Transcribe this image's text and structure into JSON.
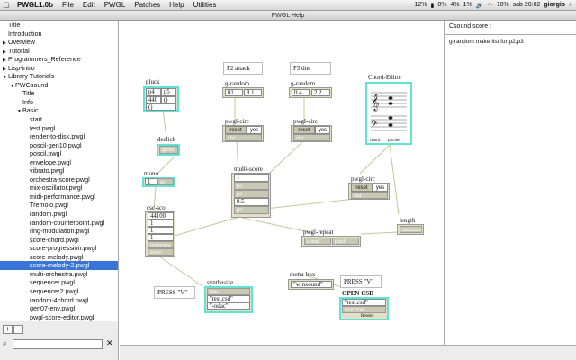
{
  "menubar": {
    "apple": "",
    "app": "PWGL1.0b",
    "items": [
      "File",
      "Edit",
      "PWGL",
      "Patches",
      "Help",
      "Utilities"
    ],
    "status": {
      "battery_pct": "12%",
      "cpu1": "0%",
      "cpu2": "4%",
      "mem": "1%",
      "wifi_pct": "70%",
      "clock": "sab 20:02",
      "user": "giorgio"
    }
  },
  "window": {
    "title": "PWGL Help"
  },
  "sidebar": {
    "items": [
      {
        "label": "Title",
        "indent": 0,
        "tri": ""
      },
      {
        "label": "Introduction",
        "indent": 0,
        "tri": ""
      },
      {
        "label": "Overview",
        "indent": 0,
        "tri": "▶"
      },
      {
        "label": "Tutorial",
        "indent": 0,
        "tri": "▶"
      },
      {
        "label": "Programmers_Reference",
        "indent": 0,
        "tri": "▶"
      },
      {
        "label": "Lisp-intro",
        "indent": 0,
        "tri": "▶"
      },
      {
        "label": "Library Tutorials",
        "indent": 0,
        "tri": "▼"
      },
      {
        "label": "PWCsound",
        "indent": 1,
        "tri": "▼"
      },
      {
        "label": "Title",
        "indent": 2,
        "tri": ""
      },
      {
        "label": "Info",
        "indent": 2,
        "tri": ""
      },
      {
        "label": "Basic",
        "indent": 2,
        "tri": "▼"
      },
      {
        "label": "start",
        "indent": 3,
        "tri": ""
      },
      {
        "label": "test.pwgl",
        "indent": 3,
        "tri": ""
      },
      {
        "label": "render-to-disk.pwgl",
        "indent": 3,
        "tri": ""
      },
      {
        "label": "poscil-gen10.pwgl",
        "indent": 3,
        "tri": ""
      },
      {
        "label": "poscil.pwgl",
        "indent": 3,
        "tri": ""
      },
      {
        "label": "envelope.pwgl",
        "indent": 3,
        "tri": ""
      },
      {
        "label": "vibrato.pwgl",
        "indent": 3,
        "tri": ""
      },
      {
        "label": "orchestra-score.pwgl",
        "indent": 3,
        "tri": ""
      },
      {
        "label": "mix-oscillator.pwgl",
        "indent": 3,
        "tri": ""
      },
      {
        "label": "midi-performance.pwgl",
        "indent": 3,
        "tri": ""
      },
      {
        "label": "Tremolo.pwgl",
        "indent": 3,
        "tri": ""
      },
      {
        "label": "random.pwgl",
        "indent": 3,
        "tri": ""
      },
      {
        "label": "random-counterpoint.pwgl",
        "indent": 3,
        "tri": ""
      },
      {
        "label": "ring-modulation.pwgl",
        "indent": 3,
        "tri": ""
      },
      {
        "label": "score-chord.pwgl",
        "indent": 3,
        "tri": ""
      },
      {
        "label": "score-progression.pwgl",
        "indent": 3,
        "tri": ""
      },
      {
        "label": "score-melody.pwgl",
        "indent": 3,
        "tri": ""
      },
      {
        "label": "score-melody-2.pwgl",
        "indent": 3,
        "tri": "",
        "selected": true
      },
      {
        "label": "multi-orchestra.pwgl",
        "indent": 3,
        "tri": ""
      },
      {
        "label": "sequencer.pwgl",
        "indent": 3,
        "tri": ""
      },
      {
        "label": "sequencer2.pwgl",
        "indent": 3,
        "tri": ""
      },
      {
        "label": "random-4chord.pwgl",
        "indent": 3,
        "tri": ""
      },
      {
        "label": "gen07-env.pwgl",
        "indent": 3,
        "tri": ""
      },
      {
        "label": "pwgl-score-editor.pwgl",
        "indent": 3,
        "tri": ""
      }
    ],
    "add_label": "+",
    "remove_label": "−",
    "search_placeholder": "",
    "clear_label": "✕"
  },
  "patch": {
    "text_p2": "P2 attack",
    "text_p3": "P3 dur",
    "text_press1": "PRESS \"V\"",
    "text_press2": "PRESS \"V\"",
    "pluck": {
      "title": "pluck",
      "v1": "p4",
      "v2": "p5",
      "v3": "440",
      "v4": "()",
      "v5": "()"
    },
    "declick": {
      "title": "declick",
      "in": "global"
    },
    "mono": {
      "title": "mono",
      "v1": "1",
      "v2": "in"
    },
    "csscs": {
      "title": "csc-sco",
      "v1": "44100",
      "v2": "1",
      "v3": "1",
      "v4": "1",
      "v5": "orchestra",
      "v6": "score"
    },
    "synthesize": {
      "title": "synthesize",
      "v1": "data",
      "v2": "\"test.csd\"",
      "v3": "\"-odac\""
    },
    "grand1": {
      "title": "g-random",
      "v1": "01",
      "v2": "8.1"
    },
    "grand2": {
      "title": "g-random",
      "v1": "0.4",
      "v2": "2.2"
    },
    "circ1": {
      "title": "pwgl-circ",
      "b1": "reset",
      "b2": "yes",
      "out": "clst"
    },
    "circ2": {
      "title": "pwgl-circ",
      "b1": "reset",
      "b2": "yes",
      "out": "clst"
    },
    "circ3": {
      "title": "pwgl-circ",
      "b1": "reset",
      "b2": "yes",
      "out": "clst"
    },
    "multiscore": {
      "title": "multi-score",
      "v1": "1",
      "v2": "p2",
      "v3": "p3",
      "v4": "0.5",
      "v5": "p5"
    },
    "chord": {
      "title": "Chord-Editor",
      "f1": "chord",
      "f2": "pitches"
    },
    "length": {
      "title": "length",
      "in": "sequence"
    },
    "repeat": {
      "title": "pwgl-repeat",
      "v1": "count",
      "v2": "patch"
    },
    "menubox": {
      "title": "menu-box",
      "v1": "\"winxound\""
    },
    "opencsd": {
      "title": "OPEN CSD",
      "v1": "\"test.csd\"",
      "v2": "EDITOR",
      "f1": "Render"
    }
  },
  "rightpanel": {
    "header": "Csound score :",
    "body": "g-random make list for p2,p3"
  },
  "colors": {
    "accent_select": "#3875d7",
    "box_cyan": "#5ee3d4",
    "box_bg": "#e3e0c8"
  }
}
